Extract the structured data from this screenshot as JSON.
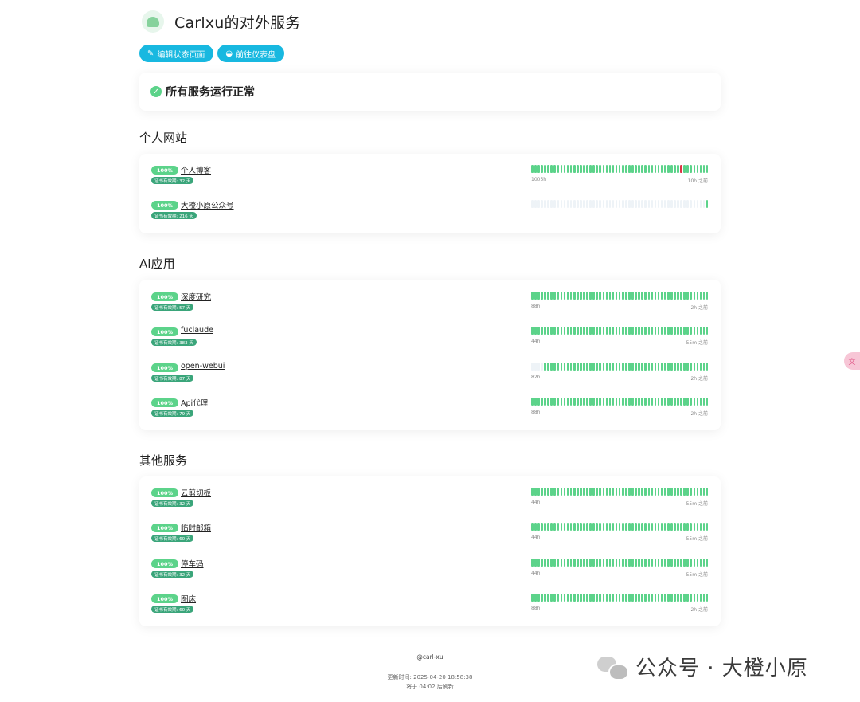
{
  "header": {
    "title": "Carlxu的对外服务"
  },
  "buttons": {
    "edit": {
      "label": "编辑状态页面",
      "icon": "edit-icon"
    },
    "dashboard": {
      "label": "前往仪表盘",
      "icon": "dashboard-icon"
    }
  },
  "status": {
    "text": "所有服务运行正常",
    "icon": "check-circle-icon"
  },
  "sections": [
    {
      "title": "个人网站",
      "items": [
        {
          "pct": "100%",
          "name": "个人博客",
          "cert": "证书有效期: 32 天",
          "left": "1005h",
          "right": "10h 之前",
          "empty": 0,
          "down": [
            46
          ]
        },
        {
          "pct": "100%",
          "name": "大橙小原公众号",
          "cert": "证书有效期: 216 天",
          "left": "",
          "right": "",
          "empty": 54,
          "down": []
        }
      ]
    },
    {
      "title": "AI应用",
      "items": [
        {
          "pct": "100%",
          "name": "深度研究",
          "cert": "证书有效期: 57 天",
          "left": "88h",
          "right": "2h 之前",
          "empty": 0,
          "down": []
        },
        {
          "pct": "100%",
          "name": "fuclaude",
          "cert": "证书有效期: 383 天",
          "left": "44h",
          "right": "55m 之前",
          "empty": 0,
          "down": []
        },
        {
          "pct": "100%",
          "name": "open-webui",
          "cert": "证书有效期: 87 天",
          "left": "82h",
          "right": "2h 之前",
          "empty": 4,
          "down": []
        },
        {
          "pct": "100%",
          "name": "Api代理",
          "cert": "证书有效期: 79 天",
          "left": "88h",
          "right": "2h 之前",
          "empty": 0,
          "down": []
        }
      ]
    },
    {
      "title": "其他服务",
      "items": [
        {
          "pct": "100%",
          "name": "云剪切板",
          "cert": "证书有效期: 32 天",
          "left": "44h",
          "right": "55m 之前",
          "empty": 0,
          "down": []
        },
        {
          "pct": "100%",
          "name": "临时邮箱",
          "cert": "证书有效期: 60 天",
          "left": "44h",
          "right": "55m 之前",
          "empty": 0,
          "down": []
        },
        {
          "pct": "100%",
          "name": "停车码",
          "cert": "证书有效期: 32 天",
          "left": "44h",
          "right": "55m 之前",
          "empty": 0,
          "down": []
        },
        {
          "pct": "100%",
          "name": "图床",
          "cert": "证书有效期: 60 天",
          "left": "88h",
          "right": "2h 之前",
          "empty": 0,
          "down": []
        }
      ]
    }
  ],
  "footer": {
    "author": "@carl-xu",
    "updated": "更新时间: 2025-04-20 18:58:38",
    "refresh": "将于 04:02 后刷新"
  },
  "watermark": {
    "text": "公众号 · 大橙小原",
    "icon": "wechat-icon"
  },
  "side_tab": {
    "label": "文",
    "icon": "translate-icon"
  },
  "colors": {
    "up": "#5cd38a",
    "down": "#dc3545",
    "empty": "#eef3f7",
    "accent": "#18b8e0"
  }
}
